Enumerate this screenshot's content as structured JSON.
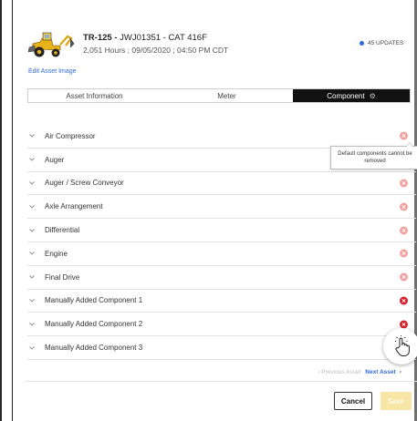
{
  "header": {
    "asset_id": "TR-125 - ",
    "asset_rest": "JWJ01351 - CAT 416F",
    "subtitle": "2,051 Hours ; 09/05/2020 ; 04:50 PM CDT",
    "updates_label": "45 UPDATES",
    "edit_image_link": "Edit Asset Image"
  },
  "tabs": [
    {
      "label": "Asset Information",
      "active": false
    },
    {
      "label": "Meter",
      "active": false
    },
    {
      "label": "Component",
      "active": true
    }
  ],
  "components": [
    {
      "label": "Air Compressor",
      "removable": false
    },
    {
      "label": "Auger",
      "removable": false
    },
    {
      "label": "Auger / Screw Conveyor",
      "removable": false
    },
    {
      "label": "Axle Arrangement",
      "removable": false
    },
    {
      "label": "Differential",
      "removable": false
    },
    {
      "label": "Engine",
      "removable": false
    },
    {
      "label": "Final Drive",
      "removable": false
    },
    {
      "label": "Manually Added Component 1",
      "removable": true
    },
    {
      "label": "Manually Added Component 2",
      "removable": true
    },
    {
      "label": "Manually Added Component 3",
      "removable": true
    }
  ],
  "tooltip": "Default components cannot be removed",
  "pager": {
    "prev_label": "Previous Asset",
    "next_label": "Next Asset"
  },
  "footer": {
    "cancel_label": "Cancel",
    "save_label": "Save"
  },
  "colors": {
    "accent_link": "#2f6bd6",
    "remove_enabled": "#d8202a",
    "remove_disabled": "#f3a2a2",
    "active_tab_bg": "#111111",
    "save_disabled_bg": "#f7e6a6"
  },
  "icons": {
    "thumbnail": "backhoe-loader-image",
    "updates": "blue-dot-icon",
    "tab_gear": "gear-icon",
    "row_expand": "chevron-down-icon",
    "remove": "remove-x-circle-icon",
    "pointer": "hand-pointer-icon"
  }
}
